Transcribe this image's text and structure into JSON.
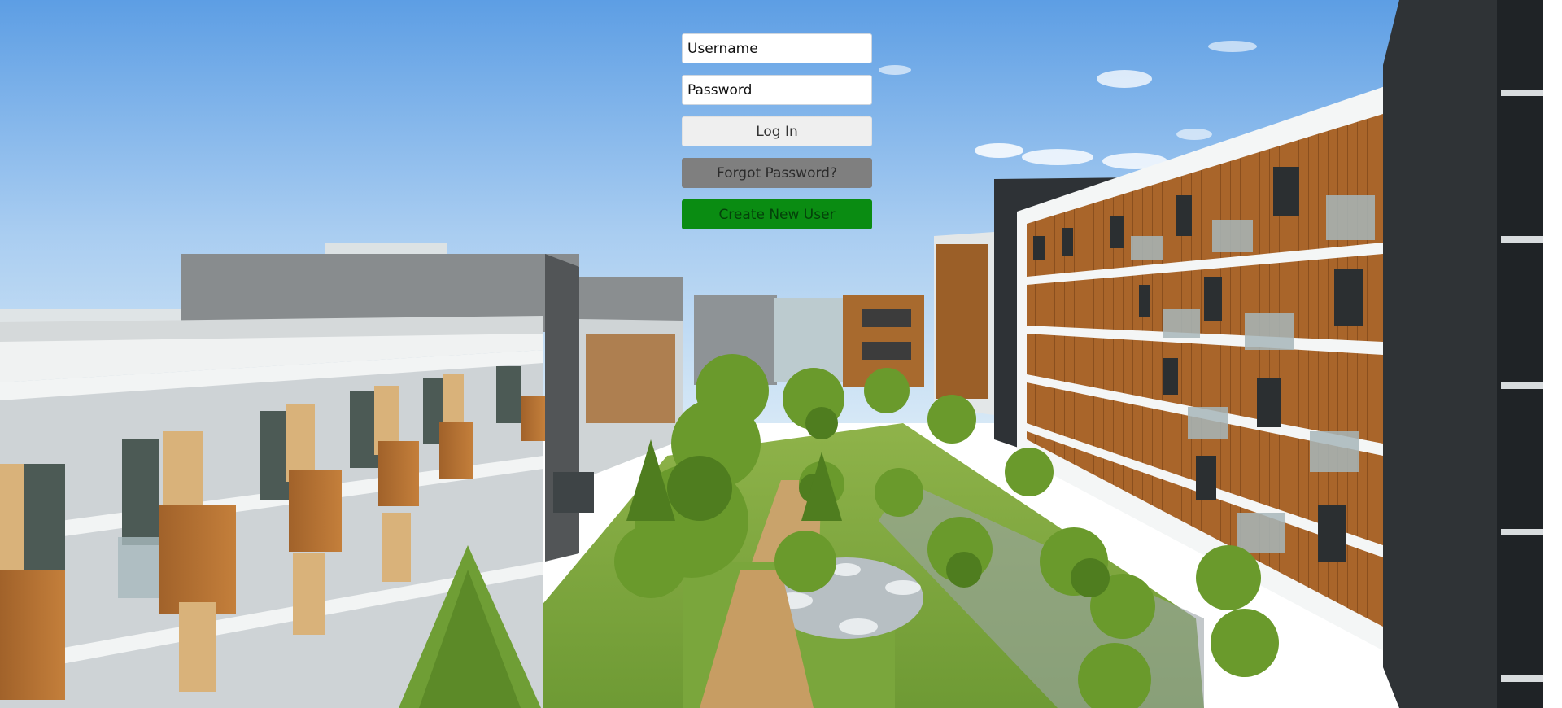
{
  "login": {
    "username_placeholder": "Username",
    "password_placeholder": "Password",
    "login_label": "Log In",
    "forgot_label": "Forgot Password?",
    "create_label": "Create New User"
  },
  "colors": {
    "login_bg": "#efefef",
    "forgot_bg": "#7f7f7f",
    "create_bg": "#0a8c12"
  }
}
